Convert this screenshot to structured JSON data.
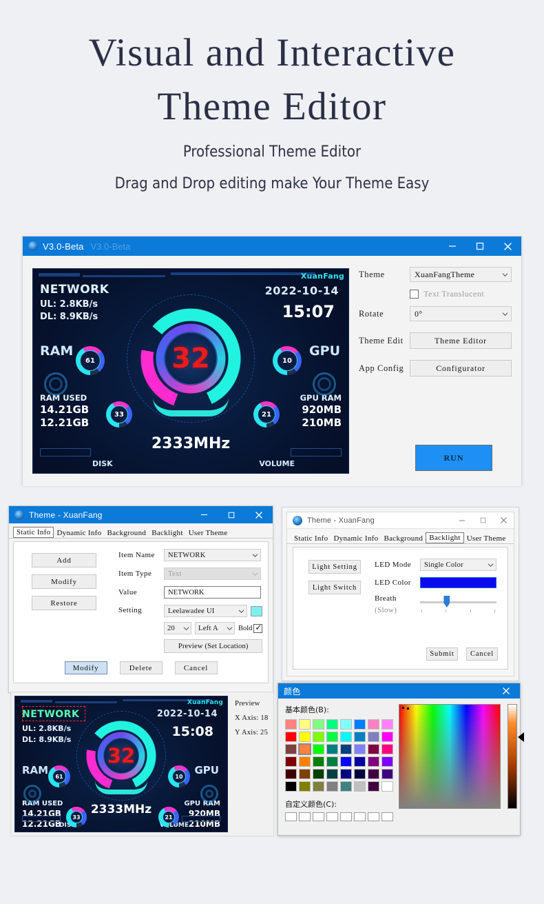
{
  "hero": {
    "title_line1": "Visual and Interactive",
    "title_line2": "Theme Editor",
    "subtitle_line1": "Professional Theme Editor",
    "subtitle_line2": "Drag and Drop editing make Your Theme Easy"
  },
  "colors": {
    "page_bg": "#eef0f4",
    "title_bar_blue": "#0b7ad8",
    "accent_button_blue": "#1e90f5",
    "dashboard_red": "#ee1b1b",
    "dashboard_cyan": "#29e6f0",
    "led_color": "#0a0af0",
    "font_swatch": "#7ff0f0"
  },
  "main_window": {
    "title": "V3.0-Beta",
    "ghost_title": "V3.0-Beta",
    "icon": "app-icon",
    "buttons": {
      "minimize": "–",
      "maximize": "☐",
      "close": "✕"
    },
    "controls": {
      "theme_label": "Theme",
      "theme_value": "XuanFangTheme",
      "translucent_label": "Text Translucent",
      "translucent_checked": false,
      "rotate_label": "Rotate",
      "rotate_value": "0°",
      "theme_edit_label": "Theme Edit",
      "theme_edit_button": "Theme Editor",
      "app_config_label": "App Config",
      "app_config_button": "Configurator",
      "run_button": "RUN"
    }
  },
  "dashboard": {
    "brand": "XuanFang",
    "network_title": "NETWORK",
    "upload": "UL: 2.8KB/s",
    "download": "DL: 8.9KB/s",
    "date": "2022-10-14",
    "time": "15:07",
    "ram_label": "RAM",
    "ram_value": "61",
    "gpu_label": "GPU",
    "gpu_value": "10",
    "cpu_value": "32",
    "ram_used_label": "RAM USED",
    "ram_used_total": "14.21GB",
    "ram_used_now": "12.21GB",
    "gpu_ram_label": "GPU RAM",
    "gpu_ram_total": "920MB",
    "gpu_ram_now": "210MB",
    "freq": "2333MHz",
    "disk_label": "DISK",
    "disk_value": "33",
    "volume_label": "VOLUME",
    "volume_value": "21"
  },
  "dashboard_preview": {
    "brand": "XuanFang",
    "network_title": "NETWORK",
    "upload": "UL: 2.8KB/s",
    "download": "DL: 8.9KB/s",
    "date": "2022-10-14",
    "time": "15:08",
    "ram_label": "RAM",
    "ram_value": "61",
    "gpu_label": "GPU",
    "gpu_value": "10",
    "cpu_value": "32",
    "ram_used_label": "RAM USED",
    "ram_used_total": "14.21GB",
    "ram_used_now": "12.21GB",
    "gpu_ram_label": "GPU RAM",
    "gpu_ram_total": "920MB",
    "gpu_ram_now": "210MB",
    "freq": "2333MHz",
    "disk_label": "DISK",
    "disk_value": "33",
    "volume_label": "VOLUME",
    "volume_value": "21",
    "preview_label": "Preview",
    "x_axis": "X Axis: 18",
    "y_axis": "Y Axis: 25"
  },
  "theme_window": {
    "title": "Theme - XuanFang",
    "icon": "app-icon",
    "buttons": {
      "minimize": "–",
      "maximize": "☐",
      "close": "✕"
    },
    "tabs": [
      {
        "label": "Static Info",
        "active": true
      },
      {
        "label": "Dynamic Info",
        "active": false
      },
      {
        "label": "Background",
        "active": false
      },
      {
        "label": "Backlight",
        "active": false
      },
      {
        "label": "User Theme",
        "active": false
      }
    ],
    "side_buttons": [
      "Add",
      "Modify",
      "Restore"
    ],
    "form": {
      "item_name_label": "Item Name",
      "item_name_value": "NETWORK",
      "item_type_label": "Item Type",
      "item_type_value": "Text",
      "item_type_disabled": true,
      "value_label": "Value",
      "value_value": "NETWORK",
      "setting_label": "Setting",
      "font_family": "Leelawadee UI",
      "font_size": "20",
      "font_align": "Left A",
      "bold_label": "Bold",
      "bold_checked": true,
      "preview_button": "Preview (Set Location)"
    },
    "foot_buttons": [
      {
        "label": "Modify",
        "primary": true
      },
      {
        "label": "Delete",
        "primary": false
      },
      {
        "label": "Cancel",
        "primary": false
      }
    ]
  },
  "backlight_window": {
    "title": "Theme - XuanFang",
    "icon": "app-icon",
    "buttons": {
      "minimize": "–",
      "maximize": "☐",
      "close": "✕"
    },
    "tabs": [
      {
        "label": "Static Info",
        "active": false
      },
      {
        "label": "Dynamic Info",
        "active": false
      },
      {
        "label": "Background",
        "active": false
      },
      {
        "label": "Backlight",
        "active": true
      },
      {
        "label": "User Theme",
        "active": false
      }
    ],
    "side_buttons": [
      "Light Setting",
      "Light Switch"
    ],
    "form": {
      "led_mode_label": "LED Mode",
      "led_mode_value": "Single Color",
      "led_color_label": "LED Color",
      "led_color_value": "#0a0af0",
      "breath_label": "Breath",
      "breath_speed": "(Slow)",
      "breath_position_percent": 31
    },
    "foot_buttons": [
      "Submit",
      "Cancel"
    ]
  },
  "color_dialog": {
    "title": "颜色",
    "close": "✕",
    "basic_colors_label": "基本颜色(B):",
    "custom_colors_label": "自定义颜色(C):",
    "selected_index": 17,
    "basic_colors": [
      "#ff8080",
      "#ffff80",
      "#80ff80",
      "#00ff80",
      "#80ffff",
      "#0080ff",
      "#ff80c0",
      "#ff80ff",
      "#ff0000",
      "#ffff00",
      "#80ff00",
      "#00ff40",
      "#00ffff",
      "#0080c0",
      "#8080c0",
      "#ff00ff",
      "#804040",
      "#ff8040",
      "#00ff00",
      "#008080",
      "#004080",
      "#8080ff",
      "#800040",
      "#ff0080",
      "#800000",
      "#ff8000",
      "#008000",
      "#008040",
      "#0000ff",
      "#0000a0",
      "#800080",
      "#8000ff",
      "#400000",
      "#804000",
      "#004000",
      "#004040",
      "#000080",
      "#000040",
      "#400040",
      "#400080",
      "#000000",
      "#808000",
      "#808040",
      "#808080",
      "#408080",
      "#c0c0c0",
      "#400040",
      "#ffffff"
    ],
    "custom_slots": 8
  }
}
